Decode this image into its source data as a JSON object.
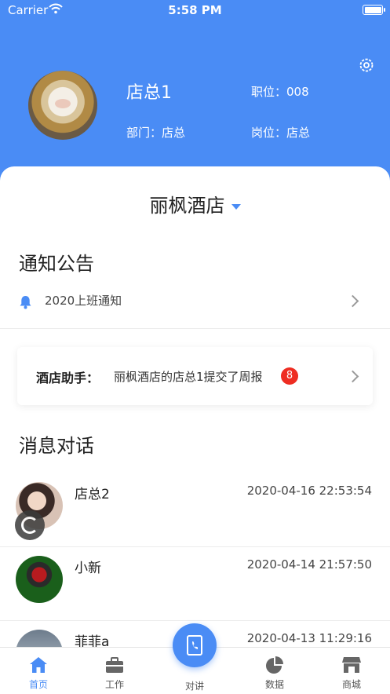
{
  "status_bar": {
    "carrier": "Carrier",
    "time": "5:58 PM"
  },
  "profile": {
    "name": "店总1",
    "position": "职位：008",
    "department": "部门：店总",
    "post": "岗位：店总"
  },
  "hotel_selector": {
    "name": "丽枫酒店"
  },
  "notices": {
    "title": "通知公告",
    "items": [
      {
        "text": "2020上班通知"
      }
    ]
  },
  "assistant": {
    "label": "酒店助手：",
    "text": "丽枫酒店的店总1提交了周报",
    "badge": "8"
  },
  "messages": {
    "title": "消息对话",
    "items": [
      {
        "name": "店总2",
        "time": "2020-04-16 22:53:54"
      },
      {
        "name": "小新",
        "time": "2020-04-14 21:57:50"
      },
      {
        "name": "菲菲a",
        "time": "2020-04-13 11:29:16"
      }
    ]
  },
  "tabbar": {
    "items": [
      {
        "label": "首页",
        "icon": "home-icon",
        "active": true
      },
      {
        "label": "工作",
        "icon": "briefcase-icon",
        "active": false
      },
      {
        "label": "对讲",
        "icon": "phone-book-icon",
        "active": false
      },
      {
        "label": "数据",
        "icon": "pie-chart-icon",
        "active": false
      },
      {
        "label": "商城",
        "icon": "store-icon",
        "active": false
      }
    ]
  },
  "colors": {
    "accent": "#4a8cf5",
    "badge": "#ee2d22"
  }
}
